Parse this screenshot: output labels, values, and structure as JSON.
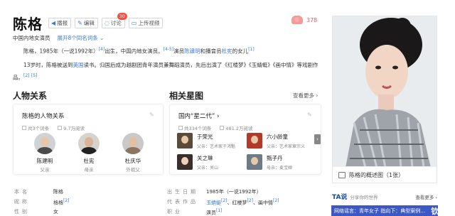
{
  "header": {
    "title": "陈格",
    "tools": [
      {
        "icon": "speaker-icon",
        "glyph": "◀)",
        "label": "播报"
      },
      {
        "icon": "pencil-icon",
        "glyph": "✎",
        "label": "编辑"
      },
      {
        "icon": "chat-icon",
        "glyph": "◌",
        "label": "讨论",
        "count": "30"
      },
      {
        "icon": "video-icon",
        "glyph": "▭",
        "label": "上传视频"
      }
    ],
    "likes": "378",
    "subtitle": "中国内地女演员",
    "other_entries": "展开8个同名词条 ⌄"
  },
  "summary": {
    "p1_a": "陈格，1985年（一说1992年）",
    "p1_ref1": "[4]",
    "p1_b": "出生，中国内地女演员。",
    "p1_ref2": "[4-5]",
    "p1_c": "演员",
    "p1_link1": "陈建明",
    "p1_d": "和播音员",
    "p1_link2": "杜宪",
    "p1_e": "的女儿",
    "p1_ref3": "[1]",
    "p2_a": "13岁时，陈格被送到",
    "p2_link": "英国",
    "p2_b": "读书。归国后成为越剧团青年演员兼舞蹈演员，先后出演了《红楼梦》《玉蜻蜓》《画中情》等戏剧作品。",
    "p2_ref1": "[2]",
    "p2_ref2": "[5]"
  },
  "relations": {
    "section_title": "人物关系",
    "card_title": "陈格的人物关系",
    "meta_entries": "共3个词条",
    "meta_views": "9.7万阅读",
    "people": [
      {
        "name": "陈建明",
        "rel": "父亲"
      },
      {
        "name": "杜宪",
        "rel": "母亲"
      },
      {
        "name": "杜庆华",
        "rel": "外祖父"
      }
    ]
  },
  "stars": {
    "section_title": "相关星图",
    "more": "查看更多 ›",
    "card_title": "国内“星二代” ›",
    "meta_entries": "共334个词条",
    "meta_views": "481.2万阅读",
    "items": [
      {
        "name": "于荣光",
        "desc": "父亲：艺术家于鸿魁"
      },
      {
        "name": "六小龄童",
        "desc": "父亲：艺术家章宗义"
      },
      {
        "name": "关之琳",
        "desc": "父亲：关山"
      },
      {
        "name": "甄子丹",
        "desc": "母亲：麦宝婵"
      }
    ]
  },
  "basic_info": {
    "rows": [
      {
        "l1": "本名",
        "v1": "陈格",
        "l2": "出生日期",
        "v2": "1985年（一说1992年）",
        "r2": ""
      },
      {
        "l1": "昵称",
        "v1": "格格",
        "r1": "[2]",
        "l2": "代表作品",
        "v2": "玉蜻蜓",
        "r2": "[2]",
        "v2b": "、红楼梦",
        "r2b": "[2]",
        "v2c": "、画中情",
        "r2c": "[2]"
      },
      {
        "l1": "性别",
        "v1": "女",
        "l2": "职业",
        "v2": "演员",
        "r2": "[1]"
      }
    ]
  },
  "photo": {
    "caption": "陈格的概述图（1张）"
  },
  "ta": {
    "logo": "TA说",
    "text": "分享你的世界",
    "more": "查看更多 ›"
  },
  "banner": {
    "text": "网络谣言：青年女子 指向下：典型案例…",
    "big": "钦号 / 猫 イ世"
  },
  "colors": {
    "link": "#3b7bd8",
    "badge": "#f24f3c",
    "banner": "#3b58c4"
  }
}
